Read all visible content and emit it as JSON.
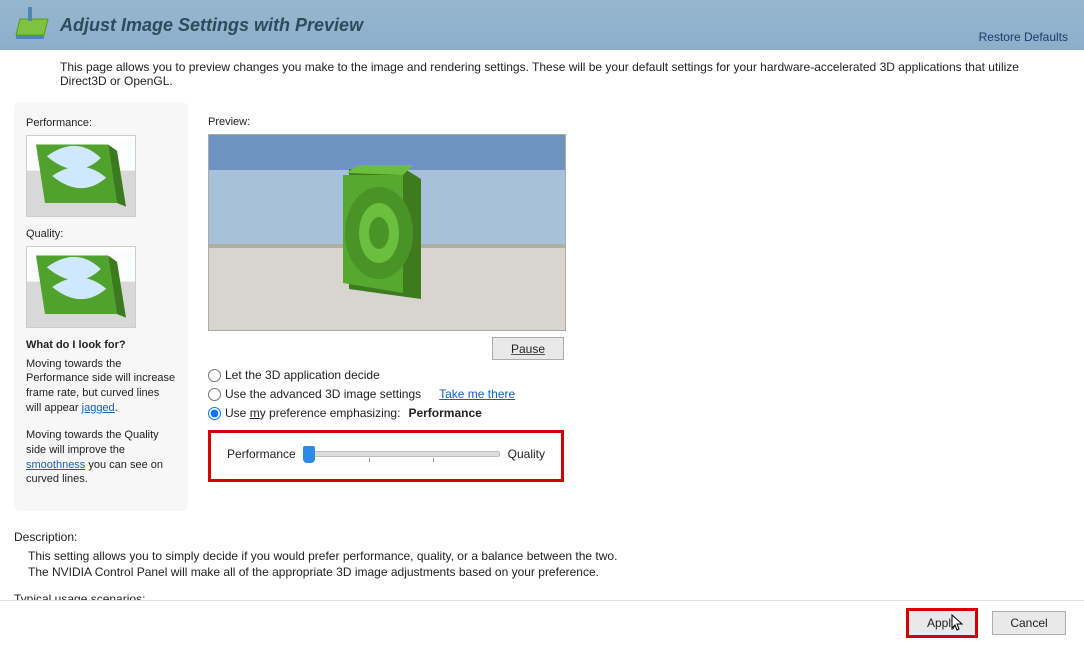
{
  "header": {
    "title": "Adjust Image Settings with Preview",
    "restore": "Restore Defaults"
  },
  "intro": "This page allows you to preview changes you make to the image and rendering settings. These will be your default settings for your hardware-accelerated 3D applications that utilize Direct3D or OpenGL.",
  "sidebar": {
    "perf_label": "Performance:",
    "qual_label": "Quality:",
    "what_title": "What do I look for?",
    "para1a": "Moving towards the Performance side will increase frame rate, but curved lines will appear ",
    "para1_link": "jagged",
    "para1b": ".",
    "para2a": "Moving towards the Quality side will improve the ",
    "para2_link": "smoothness",
    "para2b": " you can see on curved lines."
  },
  "main": {
    "preview_label": "Preview:",
    "pause": "Pause",
    "radio1": "Let the 3D application decide",
    "radio2": "Use the advanced 3D image settings",
    "take_me": "Take me there",
    "radio3_pre": "Use ",
    "radio3_u": "m",
    "radio3_post": "y preference emphasizing:",
    "emphasis": "Performance",
    "slider_left": "Performance",
    "slider_right": "Quality"
  },
  "desc": {
    "title": "Description:",
    "body1": "This setting allows you to simply decide if you would prefer performance, quality, or a balance between the two.",
    "body2": "The NVIDIA Control Panel will make all of the appropriate 3D image adjustments based on your preference.",
    "scenarios": "Typical usage scenarios:"
  },
  "footer": {
    "apply": "Apply",
    "cancel": "Cancel"
  }
}
